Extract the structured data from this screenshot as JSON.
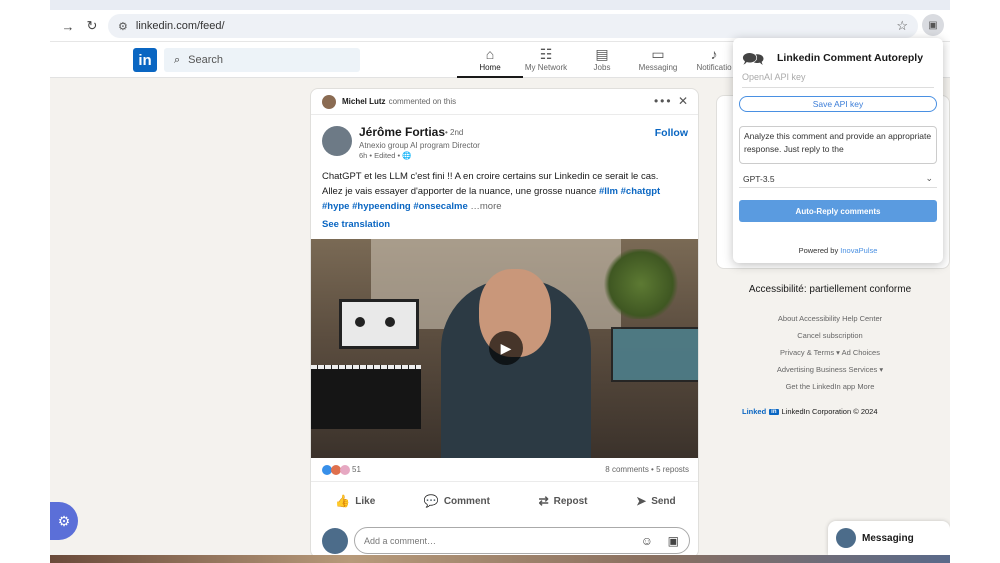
{
  "browser": {
    "url": "linkedin.com/feed/",
    "back_icon": "arrow-right",
    "reload_icon": "reload",
    "tune_icon": "tune",
    "bookmark_icon": "star",
    "extension_icon": "chat-bubbles"
  },
  "linkedin": {
    "logo": "in",
    "search_placeholder": "Search",
    "nav": [
      {
        "label": "Home",
        "icon": "home",
        "active": true
      },
      {
        "label": "My Network",
        "icon": "people"
      },
      {
        "label": "Jobs",
        "icon": "briefcase"
      },
      {
        "label": "Messaging",
        "icon": "chat"
      },
      {
        "label": "Notificatio",
        "icon": "bell"
      }
    ]
  },
  "post": {
    "context_name": "Michel Lutz",
    "context_text": "commented on this",
    "more_icon": "•••",
    "close_icon": "✕",
    "author": {
      "name": "Jérôme Fortias",
      "degree": "• 2nd",
      "headline": "Atnexio group AI program Director",
      "meta": "6h • Edited •"
    },
    "follow_label": "Follow",
    "text_line1": "ChatGPT et les LLM c'est fini !! A en croire certains sur Linkedin ce serait le cas.",
    "text_line2": "Allez je vais essayer d'apporter de la nuance, une grosse nuance",
    "hashtags_line2": [
      "#llm",
      "#chatgpt"
    ],
    "hashtags_line3": [
      "#hype",
      "#hypeending",
      "#onsecalme"
    ],
    "more_label": "…more",
    "see_translation": "See translation",
    "reactions_count": "51",
    "comments_reposts": "8 comments • 5 reposts",
    "actions": [
      {
        "label": "Like",
        "icon": "thumb-up"
      },
      {
        "label": "Comment",
        "icon": "comment"
      },
      {
        "label": "Repost",
        "icon": "repost"
      },
      {
        "label": "Send",
        "icon": "send"
      }
    ],
    "comment_placeholder": "Add a comment…"
  },
  "sidebar": {
    "accessibility": "Accessibilité: partiellement conforme",
    "footer_rows": [
      "About    Accessibility    Help Center",
      "Cancel subscription",
      "Privacy & Terms ▾    Ad Choices",
      "Advertising    Business Services ▾",
      "Get the LinkedIn app    More"
    ],
    "corp_brand": "Linked",
    "corp_in": "in",
    "corp_text": "LinkedIn Corporation © 2024"
  },
  "extension": {
    "title": "Linkedin Comment Autoreply",
    "api_key_placeholder": "OpenAI API key",
    "save_label": "Save API key",
    "prompt": "Analyze this comment and provide an appropriate response. Just reply to the",
    "model": "GPT-3.5",
    "auto_reply_label": "Auto-Reply comments",
    "powered_by": "Powered by",
    "powered_link": "InovaPulse"
  },
  "messaging_label": "Messaging"
}
